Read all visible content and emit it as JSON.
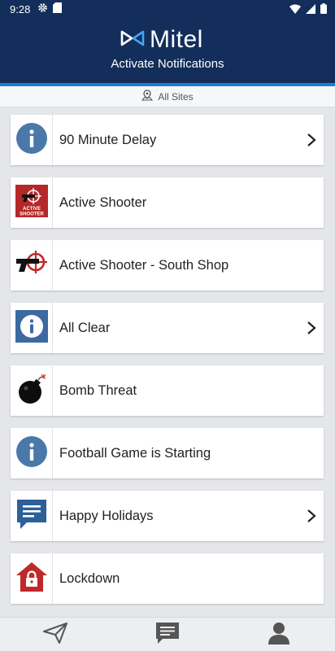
{
  "status_bar": {
    "time": "9:28"
  },
  "header": {
    "brand": "Mitel",
    "title": "Activate Notifications"
  },
  "sites_filter": {
    "label": "All Sites",
    "icon": "location-pin-icon"
  },
  "notifications": [
    {
      "label": "90 Minute Delay",
      "icon": "info-circle-icon",
      "has_chevron": true
    },
    {
      "label": "Active Shooter",
      "icon": "active-shooter-badge-icon",
      "icon_text": "ACTIVE SHOOTER",
      "has_chevron": false
    },
    {
      "label": "Active Shooter - South Shop",
      "icon": "gun-crosshair-icon",
      "has_chevron": false
    },
    {
      "label": "All Clear",
      "icon": "info-square-icon",
      "has_chevron": true
    },
    {
      "label": "Bomb Threat",
      "icon": "bomb-icon",
      "has_chevron": false
    },
    {
      "label": "Football Game is Starting",
      "icon": "info-circle-icon",
      "has_chevron": false
    },
    {
      "label": "Happy Holidays",
      "icon": "message-bubble-icon",
      "has_chevron": true
    },
    {
      "label": "Lockdown",
      "icon": "lockdown-house-icon",
      "has_chevron": false
    }
  ],
  "bottom_nav": [
    {
      "name": "send",
      "icon": "send-icon"
    },
    {
      "name": "messages",
      "icon": "messages-icon"
    },
    {
      "name": "profile",
      "icon": "profile-icon"
    }
  ],
  "colors": {
    "header": "#132e5b",
    "accent": "#1b7fd4",
    "info": "#4a78a8",
    "alert_red": "#c0282a"
  }
}
